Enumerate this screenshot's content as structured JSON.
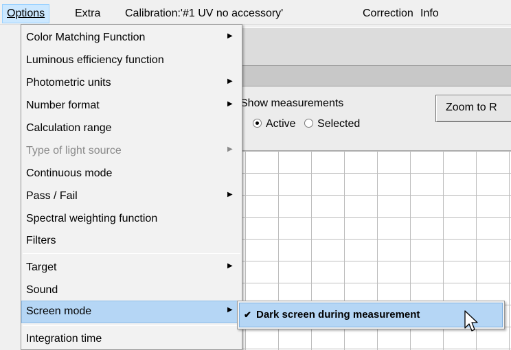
{
  "menubar": {
    "items": [
      {
        "label": "Options",
        "state": "open"
      },
      {
        "label": "Extra"
      },
      {
        "label": "Calibration:'#1 UV no accessory'"
      },
      {
        "label": "Correction"
      },
      {
        "label": "Info"
      }
    ]
  },
  "options_menu": {
    "items": [
      {
        "label": "Color Matching Function",
        "submenu": true
      },
      {
        "label": "Luminous efficiency function"
      },
      {
        "label": "Photometric units",
        "submenu": true
      },
      {
        "label": "Number format",
        "submenu": true
      },
      {
        "label": "Calculation range"
      },
      {
        "label": "Type of light source",
        "submenu": true,
        "disabled": true
      },
      {
        "label": "Continuous mode"
      },
      {
        "label": "Pass / Fail",
        "submenu": true
      },
      {
        "label": "Spectral weighting function"
      },
      {
        "label": "Filters"
      },
      {
        "label": "Target",
        "submenu": true
      },
      {
        "label": "Sound"
      },
      {
        "label": "Screen mode",
        "submenu": true,
        "highlighted": true
      },
      {
        "label": "Integration time"
      }
    ]
  },
  "screen_mode_submenu": {
    "items": [
      {
        "label": "Dark screen during measurement",
        "checked": true
      }
    ]
  },
  "background": {
    "show_measurements_label": "Show measurements",
    "radio_active": "Active",
    "radio_selected": "Selected",
    "selected_radio": "Active",
    "zoom_button": "Zoom to R"
  },
  "glyphs": {
    "submenu_arrow": "▶",
    "check": "✔"
  },
  "colors": {
    "highlight": "#b5d6f5",
    "menubar_active": "#cce8ff",
    "disabled_text": "#8a8a8a"
  }
}
